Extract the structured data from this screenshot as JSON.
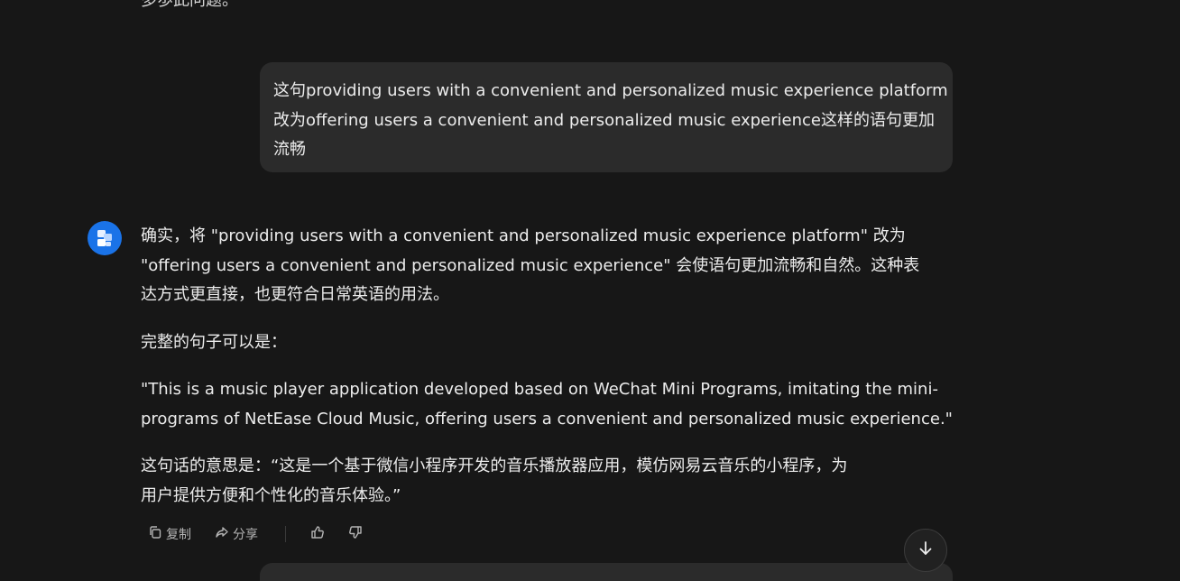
{
  "previous_message_fragment": "多歩此问题。",
  "user_message": {
    "lines": [
      "这句providing users with a convenient and personalized music experience platform",
      "改为offering users a convenient and personalized music experience这样的语句更加",
      "流畅"
    ]
  },
  "assistant_message": {
    "paragraph1": [
      "确实，将 \"providing users with a convenient and personalized music experience platform\" 改为",
      "\"offering users a convenient and personalized music experience\" 会使语句更加流畅和自然。这种表",
      "达方式更直接，也更符合日常英语的用法。"
    ],
    "paragraph2": "完整的句子可以是：",
    "paragraph3": [
      "\"This is a music player application developed based on WeChat Mini Programs, imitating the mini-",
      "programs of NetEase Cloud Music, offering users a convenient and personalized music experience.\""
    ],
    "paragraph4": [
      "这句话的意思是：“这是一个基于微信小程序开发的音乐播放器应用，模仿网易云音乐的小程序，为",
      "用户提供方便和个性化的音乐体验。”"
    ]
  },
  "actions": {
    "copy_label": "复制",
    "share_label": "分享"
  },
  "colors": {
    "background": "#171717",
    "bubble": "#2b2b2b",
    "avatar_blue": "#1a73e8",
    "text": "#ececec",
    "muted": "#b4b4b4"
  },
  "icons": [
    "copy-icon",
    "share-icon",
    "thumbs-up-icon",
    "thumbs-down-icon",
    "arrow-down-icon",
    "assistant-avatar"
  ]
}
